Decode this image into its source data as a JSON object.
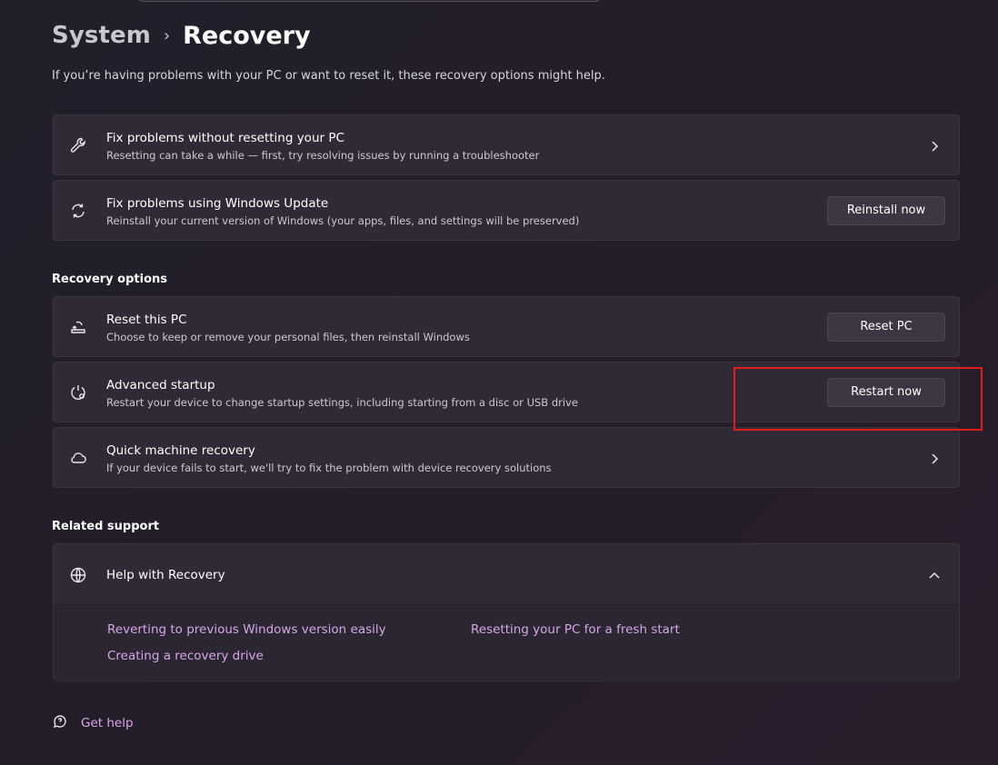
{
  "breadcrumb": {
    "parent": "System",
    "separator": "›",
    "current": "Recovery"
  },
  "intro": "If you’re having problems with your PC or want to reset it, these recovery options might help.",
  "top_cards": [
    {
      "title": "Fix problems without resetting your PC",
      "desc": "Resetting can take a while — first, try resolving issues by running a troubleshooter",
      "icon": "wrench-icon"
    },
    {
      "title": "Fix problems using Windows Update",
      "desc": "Reinstall your current version of Windows (your apps, files, and settings will be preserved)",
      "icon": "sync-icon",
      "button": "Reinstall now"
    }
  ],
  "recovery_options": {
    "heading": "Recovery options",
    "items": [
      {
        "title": "Reset this PC",
        "desc": "Choose to keep or remove your personal files, then reinstall Windows",
        "icon": "reset-pc-icon",
        "button": "Reset PC"
      },
      {
        "title": "Advanced startup",
        "desc": "Restart your device to change startup settings, including starting from a disc or USB drive",
        "icon": "power-gear-icon",
        "button": "Restart now"
      },
      {
        "title": "Quick machine recovery",
        "desc": "If your device fails to start, we'll try to fix the problem with device recovery solutions",
        "icon": "cloud-icon"
      }
    ]
  },
  "related_support": {
    "heading": "Related support",
    "help_title": "Help with Recovery",
    "links": [
      "Reverting to previous Windows version easily",
      "Resetting your PC for a fresh start",
      "Creating a recovery drive"
    ]
  },
  "get_help": "Get help",
  "colors": {
    "accent_link": "#d6a7e6",
    "highlight": "#e21b1b",
    "card": "#2f2a36"
  }
}
